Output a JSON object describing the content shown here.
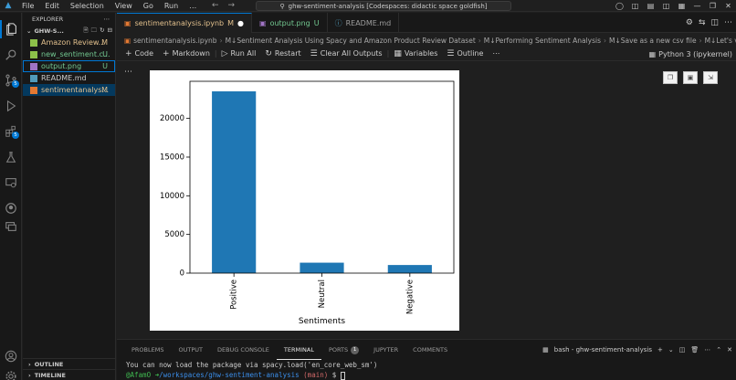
{
  "titlebar": {
    "menu": [
      "File",
      "Edit",
      "Selection",
      "View",
      "Go",
      "Run",
      "…"
    ],
    "command_center": "ghw-sentiment-analysis [Codespaces: didactic space goldfish]"
  },
  "activitybar": {
    "scm_badge": "5",
    "extensions_badge": "5"
  },
  "sidebar": {
    "header": "EXPLORER",
    "root": "GHW-S...",
    "files": [
      {
        "name": "Amazon Review...",
        "status": "M",
        "color": "#e2c08d",
        "icon_color": "#8dc149"
      },
      {
        "name": "new_sentiment.c...",
        "status": "U",
        "color": "#73c991",
        "icon_color": "#8dc149"
      },
      {
        "name": "output.png",
        "status": "U",
        "color": "#73c991",
        "icon_color": "#a074c4"
      },
      {
        "name": "README.md",
        "status": "",
        "color": "#cccccc",
        "icon_color": "#519aba"
      },
      {
        "name": "sentimentanalys...",
        "status": "M",
        "color": "#e2c08d",
        "icon_color": "#e37933"
      }
    ],
    "outline": "OUTLINE",
    "timeline": "TIMELINE"
  },
  "tabs": [
    {
      "label": "sentimentanalysis.ipynb",
      "status": "M"
    },
    {
      "label": "output.png",
      "status": "U"
    },
    {
      "label": "README.md",
      "status": ""
    }
  ],
  "breadcrumb": [
    "sentimentanalysis.ipynb",
    "M↓Sentiment Analysis Using Spacy and  Amazon Product  Review Dataset",
    "M↓Performing Sentiment Analysis",
    "M↓Save as a new csv file",
    "M↓Let's visualize the distrib"
  ],
  "toolbar": {
    "code": "Code",
    "markdown": "Markdown",
    "run_all": "Run All",
    "restart": "Restart",
    "clear_outputs": "Clear All Outputs",
    "variables": "Variables",
    "outline": "Outline",
    "kernel": "Python 3 (ipykernel)"
  },
  "chart_data": {
    "type": "bar",
    "categories": [
      "Positive",
      "Neutral",
      "Negative"
    ],
    "values": [
      23500,
      1350,
      1050
    ],
    "xlabel": "Sentiments",
    "ylabel": "",
    "ylim": [
      0,
      24800
    ],
    "yticks": [
      0,
      5000,
      10000,
      15000,
      20000
    ],
    "color": "#1f77b4",
    "grid": false
  },
  "panel": {
    "tabs": [
      "PROBLEMS",
      "OUTPUT",
      "DEBUG CONSOLE",
      "TERMINAL",
      "PORTS",
      "JUPYTER",
      "COMMENTS"
    ],
    "ports_count": "1",
    "terminal_name": "bash - ghw-sentiment-analysis",
    "line1": "You can now load the package via spacy.load('en_core_web_sm')",
    "prompt_user": "@AfamO",
    "prompt_arrow": "➜",
    "prompt_path": "/workspaces/ghw-sentiment-analysis",
    "prompt_branch": "(main)",
    "prompt_symbol": "$"
  }
}
